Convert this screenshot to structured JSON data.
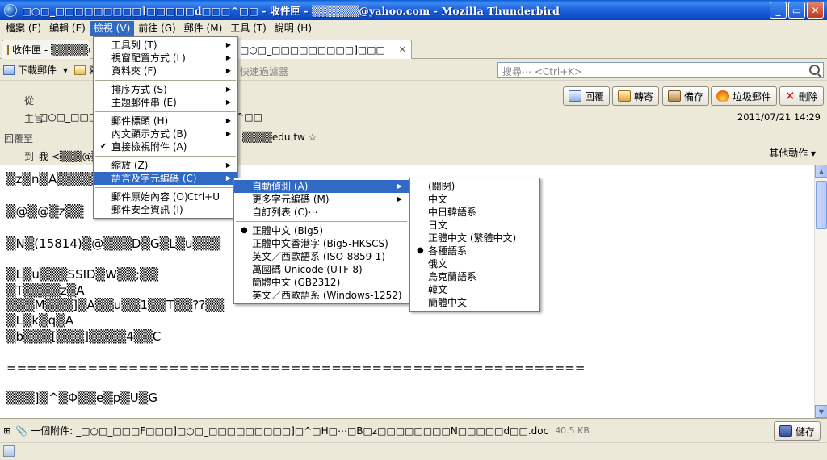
{
  "window": {
    "title": "□○□_□□□□□□□□□]□□□□□d□□□^□□ - 收件匣 - ▒▒▒▒▒▒@yahoo.com - Mozilla Thunderbird",
    "controls": [
      "_",
      "▭",
      "✕"
    ]
  },
  "menubar": [
    {
      "label": "檔案 (F)"
    },
    {
      "label": "編輯 (E)"
    },
    {
      "label": "檢視 (V)",
      "active": true
    },
    {
      "label": "前往 (G)"
    },
    {
      "label": "郵件 (M)"
    },
    {
      "label": "工具 (T)"
    },
    {
      "label": "說明 (H)"
    }
  ],
  "tabs": {
    "inbox": "收件匣 - ▒▒▒▒▒@",
    "message": "□○□_□□□□□□□□□]□□□",
    "close": "✕"
  },
  "toolbar": {
    "get_mail": "下載郵件",
    "dropdown": "▾",
    "write": "寫",
    "quick_filter": "快速過濾器",
    "search_placeholder": "搜尋⋯ <Ctrl+K>"
  },
  "header": {
    "labels": {
      "from": "從",
      "subject": "主旨",
      "reply_to": "回覆至",
      "to": "到"
    },
    "subject_value": "□○□_□□□□□□□□□]□□□□□d□□□^□□",
    "reply_to_value": "▒▒▒▒edu.tw ☆",
    "to_value": "我 <▒▒▒@▒▒▒>",
    "date": "2011/07/21 14:29",
    "other_actions": "其他動作 ▾",
    "buttons": [
      "回覆",
      "轉寄",
      "備存",
      "垃圾郵件",
      "刪除"
    ]
  },
  "body_lines": [
    "▒z▒n▒A▒▒▒▒▒▒▒▒",
    "▒@▒@▒z▒▒",
    "▒N▒(15814)▒@▒▒▒D▒G▒L▒u▒▒▒",
    "▒L▒u▒▒▒SSID▒W▒▒;▒▒",
    "▒T▒▒▒▒z▒A",
    "▒▒▒M▒▒▒]▒A▒▒u▒▒1▒▒T▒▒??▒▒",
    "▒L▒k▒q▒A",
    "▒b▒▒▒[▒▒▒]▒▒▒▒4▒▒C",
    "=========================================================",
    "▒▒▒]▒^▒Φ▒▒e▒p▒U▒G"
  ],
  "attachment": {
    "count_label": "一個附件:",
    "filename": "_□○□_□□□F□□□]□○□_□□□□□□□□□]□^□H□⋯□B□z□□□□□□□□N□□□□□d□□.doc",
    "size": "40.5 KB",
    "save": "儲存"
  },
  "view_menu": {
    "items": [
      {
        "label": "工具列 (T)",
        "sub": true
      },
      {
        "label": "視窗配置方式 (L)",
        "sub": true
      },
      {
        "label": "資料夾 (F)",
        "sub": true
      },
      {
        "sep": true
      },
      {
        "label": "排序方式 (S)",
        "sub": true
      },
      {
        "label": "主題郵件串 (E)",
        "sub": true
      },
      {
        "sep": true
      },
      {
        "label": "郵件標頭 (H)",
        "sub": true
      },
      {
        "label": "內文顯示方式 (B)",
        "sub": true
      },
      {
        "label": "直接檢視附件 (A)",
        "check": true
      },
      {
        "sep": true
      },
      {
        "label": "縮放 (Z)",
        "sub": true
      },
      {
        "label": "語言及字元編碼 (C)",
        "sub": true,
        "hl": true
      },
      {
        "sep": true
      },
      {
        "label": "郵件原始內容 (O)",
        "accel": "Ctrl+U"
      },
      {
        "label": "郵件安全資訊 (I)"
      }
    ]
  },
  "encoding_menu": {
    "items": [
      {
        "label": "自動偵測 (A)",
        "sub": true,
        "hl": true
      },
      {
        "label": "更多字元編碼 (M)",
        "sub": true
      },
      {
        "label": "自訂列表 (C)⋯"
      },
      {
        "sep": true
      },
      {
        "label": "正體中文 (Big5)",
        "radio": true
      },
      {
        "label": "正體中文香港字 (Big5-HKSCS)"
      },
      {
        "label": "英文／西歐語系 (ISO-8859-1)"
      },
      {
        "label": "萬國碼 Unicode (UTF-8)"
      },
      {
        "label": "簡體中文 (GB2312)"
      },
      {
        "label": "英文／西歐語系 (Windows-1252)"
      }
    ]
  },
  "autodetect_menu": {
    "items": [
      {
        "label": "(關閉)"
      },
      {
        "label": "中文"
      },
      {
        "label": "中日韓語系"
      },
      {
        "label": "日文"
      },
      {
        "label": "正體中文 (繁體中文)"
      },
      {
        "label": "各種語系",
        "radio": true
      },
      {
        "label": "俄文"
      },
      {
        "label": "烏克蘭語系"
      },
      {
        "label": "韓文"
      },
      {
        "label": "簡體中文"
      }
    ]
  },
  "colors": {
    "highlight": "#316ac5",
    "titlebar": "#0c49c2",
    "chrome": "#ece9d8"
  }
}
